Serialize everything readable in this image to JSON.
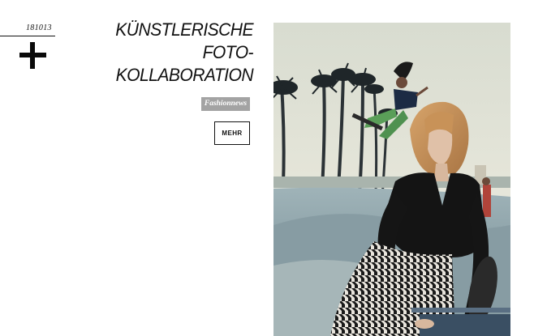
{
  "article": {
    "date": "181013",
    "title_lines": [
      "KÜNSTLERISCHE",
      "FOTO-",
      "KOLLABORATION"
    ],
    "category": "Fashionnews",
    "more_label": "MEHR"
  },
  "icons": {
    "expand": "plus-icon"
  },
  "colors": {
    "text": "#111111",
    "tag_bg": "#a3a3a3",
    "tag_text": "#ffffff",
    "background": "#ffffff"
  }
}
